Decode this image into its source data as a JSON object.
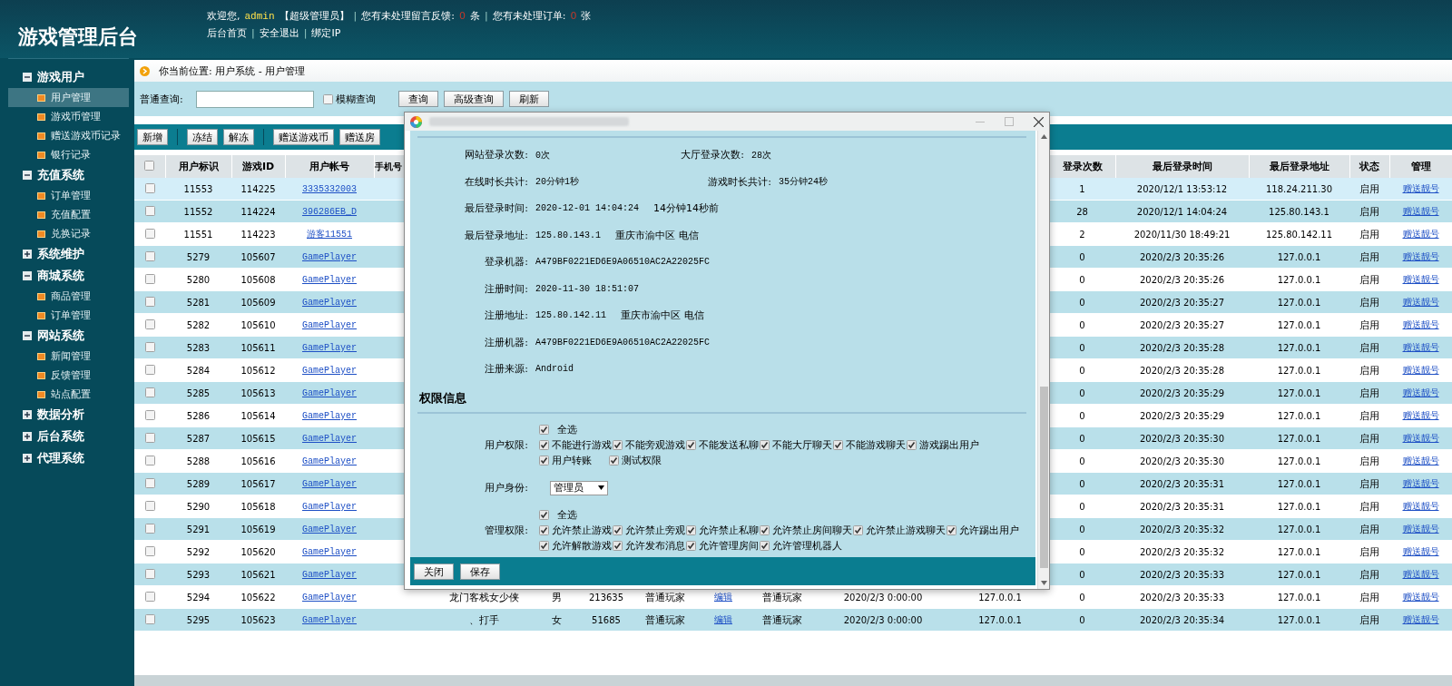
{
  "header": {
    "title": "游戏管理后台",
    "welcome": {
      "greeting": "欢迎您,",
      "user": "admin",
      "role": "【超级管理员】",
      "feedback_label": "您有未处理留言反馈:",
      "feedback_count": "0",
      "feedback_unit": "条",
      "orders_label": "您有未处理订单:",
      "orders_count": "0",
      "orders_unit": "张"
    },
    "links": [
      "后台首页",
      "安全退出",
      "绑定IP"
    ],
    "separator": "|"
  },
  "sidebar": {
    "groups": [
      {
        "label": "游戏用户",
        "expanded": true,
        "items": [
          {
            "label": "用户管理",
            "selected": true
          },
          {
            "label": "游戏币管理",
            "selected": false
          },
          {
            "label": "赠送游戏币记录",
            "selected": false
          },
          {
            "label": "银行记录",
            "selected": false
          }
        ]
      },
      {
        "label": "充值系统",
        "expanded": true,
        "items": [
          {
            "label": "订单管理",
            "selected": false
          },
          {
            "label": "充值配置",
            "selected": false
          },
          {
            "label": "兑换记录",
            "selected": false
          }
        ]
      },
      {
        "label": "系统维护",
        "expanded": false
      },
      {
        "label": "商城系统",
        "expanded": true,
        "items": [
          {
            "label": "商品管理",
            "selected": false
          },
          {
            "label": "订单管理",
            "selected": false
          }
        ]
      },
      {
        "label": "网站系统",
        "expanded": true,
        "items": [
          {
            "label": "新闻管理",
            "selected": false
          },
          {
            "label": "反馈管理",
            "selected": false
          },
          {
            "label": "站点配置",
            "selected": false
          }
        ]
      },
      {
        "label": "数据分析",
        "expanded": false
      },
      {
        "label": "后台系统",
        "expanded": false
      },
      {
        "label": "代理系统",
        "expanded": false
      }
    ]
  },
  "breadcrumb": "你当前位置: 用户系统 - 用户管理",
  "search": {
    "label": "普通查询:",
    "fuzzy": {
      "label": "模糊查询",
      "checked": false
    },
    "buttons": [
      "查询",
      "高级查询",
      "刷新"
    ]
  },
  "toolbar": {
    "buttons": [
      "新增",
      "冻结",
      "解冻",
      "赠送游戏币",
      "赠送房"
    ]
  },
  "table": {
    "select_all": false,
    "columns": [
      "用户标识",
      "游戏ID",
      "用户帐号",
      "手机号",
      "登录次数",
      "最后登录时间",
      "最后登录地址",
      "状态",
      "管理"
    ],
    "rows": [
      {
        "selected": true,
        "checked": false,
        "user_id": "11553",
        "game_id": "114225",
        "account": "3335332003",
        "login_count": "1",
        "last_login_time": "2020/12/1 13:53:12",
        "last_login_ip": "118.24.211.30",
        "status": "启用",
        "action": "赠送靓号"
      },
      {
        "selected": false,
        "checked": false,
        "user_id": "11552",
        "game_id": "114224",
        "account": "396286EB_D",
        "login_count": "28",
        "last_login_time": "2020/12/1 14:04:24",
        "last_login_ip": "125.80.143.1",
        "status": "启用",
        "action": "赠送靓号"
      },
      {
        "selected": false,
        "checked": false,
        "user_id": "11551",
        "game_id": "114223",
        "account": "游客11551",
        "login_count": "2",
        "last_login_time": "2020/11/30 18:49:21",
        "last_login_ip": "125.80.142.11",
        "status": "启用",
        "action": "赠送靓号"
      },
      {
        "selected": false,
        "checked": false,
        "user_id": "5279",
        "game_id": "105607",
        "account": "GamePlayer",
        "login_count": "0",
        "last_login_time": "2020/2/3 20:35:26",
        "last_login_ip": "127.0.0.1",
        "status": "启用",
        "action": "赠送靓号"
      },
      {
        "selected": false,
        "checked": false,
        "user_id": "5280",
        "game_id": "105608",
        "account": "GamePlayer",
        "login_count": "0",
        "last_login_time": "2020/2/3 20:35:26",
        "last_login_ip": "127.0.0.1",
        "status": "启用",
        "action": "赠送靓号"
      },
      {
        "selected": false,
        "checked": false,
        "user_id": "5281",
        "game_id": "105609",
        "account": "GamePlayer",
        "login_count": "0",
        "last_login_time": "2020/2/3 20:35:27",
        "last_login_ip": "127.0.0.1",
        "status": "启用",
        "action": "赠送靓号"
      },
      {
        "selected": false,
        "checked": false,
        "user_id": "5282",
        "game_id": "105610",
        "account": "GamePlayer",
        "login_count": "0",
        "last_login_time": "2020/2/3 20:35:27",
        "last_login_ip": "127.0.0.1",
        "status": "启用",
        "action": "赠送靓号"
      },
      {
        "selected": false,
        "checked": false,
        "user_id": "5283",
        "game_id": "105611",
        "account": "GamePlayer",
        "login_count": "0",
        "last_login_time": "2020/2/3 20:35:28",
        "last_login_ip": "127.0.0.1",
        "status": "启用",
        "action": "赠送靓号"
      },
      {
        "selected": false,
        "checked": false,
        "user_id": "5284",
        "game_id": "105612",
        "account": "GamePlayer",
        "login_count": "0",
        "last_login_time": "2020/2/3 20:35:28",
        "last_login_ip": "127.0.0.1",
        "status": "启用",
        "action": "赠送靓号"
      },
      {
        "selected": false,
        "checked": false,
        "user_id": "5285",
        "game_id": "105613",
        "account": "GamePlayer",
        "login_count": "0",
        "last_login_time": "2020/2/3 20:35:29",
        "last_login_ip": "127.0.0.1",
        "status": "启用",
        "action": "赠送靓号"
      },
      {
        "selected": false,
        "checked": false,
        "user_id": "5286",
        "game_id": "105614",
        "account": "GamePlayer",
        "login_count": "0",
        "last_login_time": "2020/2/3 20:35:29",
        "last_login_ip": "127.0.0.1",
        "status": "启用",
        "action": "赠送靓号"
      },
      {
        "selected": false,
        "checked": false,
        "user_id": "5287",
        "game_id": "105615",
        "account": "GamePlayer",
        "login_count": "0",
        "last_login_time": "2020/2/3 20:35:30",
        "last_login_ip": "127.0.0.1",
        "status": "启用",
        "action": "赠送靓号"
      },
      {
        "selected": false,
        "checked": false,
        "user_id": "5288",
        "game_id": "105616",
        "account": "GamePlayer",
        "login_count": "0",
        "last_login_time": "2020/2/3 20:35:30",
        "last_login_ip": "127.0.0.1",
        "status": "启用",
        "action": "赠送靓号"
      },
      {
        "selected": false,
        "checked": false,
        "user_id": "5289",
        "game_id": "105617",
        "account": "GamePlayer",
        "login_count": "0",
        "last_login_time": "2020/2/3 20:35:31",
        "last_login_ip": "127.0.0.1",
        "status": "启用",
        "action": "赠送靓号"
      },
      {
        "selected": false,
        "checked": false,
        "user_id": "5290",
        "game_id": "105618",
        "account": "GamePlayer",
        "login_count": "0",
        "last_login_time": "2020/2/3 20:35:31",
        "last_login_ip": "127.0.0.1",
        "status": "启用",
        "action": "赠送靓号"
      },
      {
        "selected": false,
        "checked": false,
        "user_id": "5291",
        "game_id": "105619",
        "account": "GamePlayer",
        "login_count": "0",
        "last_login_time": "2020/2/3 20:35:32",
        "last_login_ip": "127.0.0.1",
        "status": "启用",
        "action": "赠送靓号"
      },
      {
        "selected": false,
        "checked": false,
        "user_id": "5292",
        "game_id": "105620",
        "account": "GamePlayer",
        "login_count": "0",
        "last_login_time": "2020/2/3 20:35:32",
        "last_login_ip": "127.0.0.1",
        "status": "启用",
        "action": "赠送靓号"
      },
      {
        "selected": false,
        "checked": false,
        "user_id": "5293",
        "game_id": "105621",
        "account": "GamePlayer",
        "login_count": "0",
        "last_login_time": "2020/2/3 20:35:33",
        "last_login_ip": "127.0.0.1",
        "status": "启用",
        "action": "赠送靓号"
      },
      {
        "selected": false,
        "checked": false,
        "user_id": "5294",
        "game_id": "105622",
        "account": "GamePlayer",
        "nickname": "龙门客栈女少侠",
        "gender": "男",
        "column_8": "213635",
        "type": "普通玩家",
        "edit": "编辑",
        "role": "普通玩家",
        "reg_time": "2020/2/3 0:00:00",
        "reg_ip": "127.0.0.1",
        "login_count": "0",
        "last_login_time": "2020/2/3 20:35:33",
        "last_login_ip": "127.0.0.1",
        "status": "启用",
        "action": "赠送靓号"
      },
      {
        "selected": false,
        "checked": false,
        "user_id": "5295",
        "game_id": "105623",
        "account": "GamePlayer",
        "nickname": "、打手",
        "gender": "女",
        "column_8": "51685",
        "type": "普通玩家",
        "edit": "编辑",
        "role": "普通玩家",
        "reg_time": "2020/2/3 0:00:00",
        "reg_ip": "127.0.0.1",
        "login_count": "0",
        "last_login_time": "2020/2/3 20:35:34",
        "last_login_ip": "127.0.0.1",
        "status": "启用",
        "action": "赠送靓号"
      }
    ]
  },
  "dialog": {
    "info": [
      {
        "label": "网站登录次数:",
        "value": "0次",
        "pair": {
          "label": "大厅登录次数:",
          "value": "28次"
        }
      },
      {
        "label": "在线时长共计:",
        "value": "20分钟1秒",
        "pair": {
          "label": "游戏时长共计:",
          "value": "35分钟24秒"
        }
      },
      {
        "label": "最后登录时间:",
        "value": "2020-12-01 14:04:24",
        "note": "14分钟14秒前"
      },
      {
        "label": "最后登录地址:",
        "value": "125.80.143.1",
        "note": "重庆市渝中区 电信"
      },
      {
        "label": "登录机器:",
        "value": "A479BF0221ED6E9A06510AC2A22025FC"
      },
      {
        "label": "注册时间:",
        "value": "2020-11-30 18:51:07"
      },
      {
        "label": "注册地址:",
        "value": "125.80.142.11",
        "note": "重庆市渝中区 电信"
      },
      {
        "label": "注册机器:",
        "value": "A479BF0221ED6E9A06510AC2A22025FC"
      },
      {
        "label": "注册来源:",
        "value": "Android"
      }
    ],
    "section_title": "权限信息",
    "user_permissions": {
      "label": "用户权限:",
      "select_all": {
        "label": "全选",
        "checked": true
      },
      "items": [
        {
          "label": "不能进行游戏",
          "checked": true
        },
        {
          "label": "不能旁观游戏",
          "checked": true
        },
        {
          "label": "不能发送私聊",
          "checked": true
        },
        {
          "label": "不能大厅聊天",
          "checked": true
        },
        {
          "label": "不能游戏聊天",
          "checked": true
        },
        {
          "label": "游戏踢出用户",
          "checked": true
        },
        {
          "label": "用户转账",
          "checked": true
        },
        {
          "label": "测试权限",
          "checked": true
        }
      ]
    },
    "identity": {
      "label": "用户身份:",
      "value": "管理员"
    },
    "admin_permissions": {
      "label": "管理权限:",
      "select_all": {
        "label": "全选",
        "checked": true
      },
      "items": [
        {
          "label": "允许禁止游戏",
          "checked": true
        },
        {
          "label": "允许禁止旁观",
          "checked": true
        },
        {
          "label": "允许禁止私聊",
          "checked": true
        },
        {
          "label": "允许禁止房间聊天",
          "checked": true
        },
        {
          "label": "允许禁止游戏聊天",
          "checked": true
        },
        {
          "label": "允许踢出用户",
          "checked": true
        },
        {
          "label": "允许解散游戏",
          "checked": true
        },
        {
          "label": "允许发布消息",
          "checked": true
        },
        {
          "label": "允许管理房间",
          "checked": true
        },
        {
          "label": "允许管理机器人",
          "checked": true
        }
      ]
    },
    "buttons": [
      "关闭",
      "保存"
    ]
  }
}
